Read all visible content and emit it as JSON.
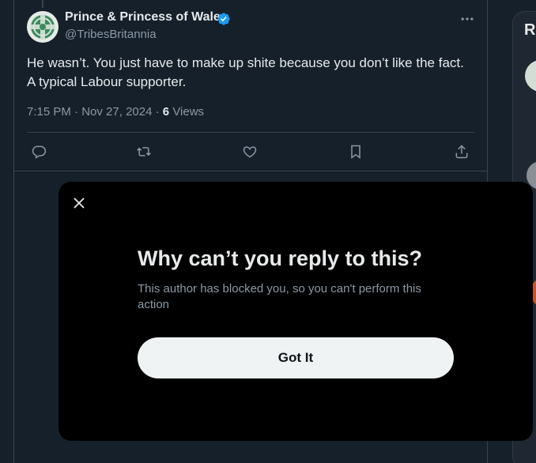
{
  "tweet": {
    "author_name": "Prince & Princess of Wales",
    "handle": "@TribesBritannia",
    "verified_icon": "verified-badge-icon",
    "text": "He wasn’t. You just have to make up shite because you don’t like the fact. A typical Labour supporter.",
    "time": "7:15 PM",
    "date": "Nov 27, 2024",
    "separator": "·",
    "views_count": "6",
    "views_label": "Views",
    "actions": [
      "reply-icon",
      "retweet-icon",
      "like-icon",
      "bookmark-icon",
      "share-icon"
    ]
  },
  "sidebar": {
    "heading_fragment": "R"
  },
  "modal": {
    "title": "Why can’t you reply to this?",
    "body": "This author has blocked you, so you can't perform this action",
    "button_label": "Got It",
    "close_icon": "close-icon"
  },
  "colors": {
    "background": "#15202b",
    "modal_background": "#000000",
    "verified": "#1d9bf0",
    "secondary_text": "#8b98a5",
    "button_background": "#eff3f4"
  }
}
